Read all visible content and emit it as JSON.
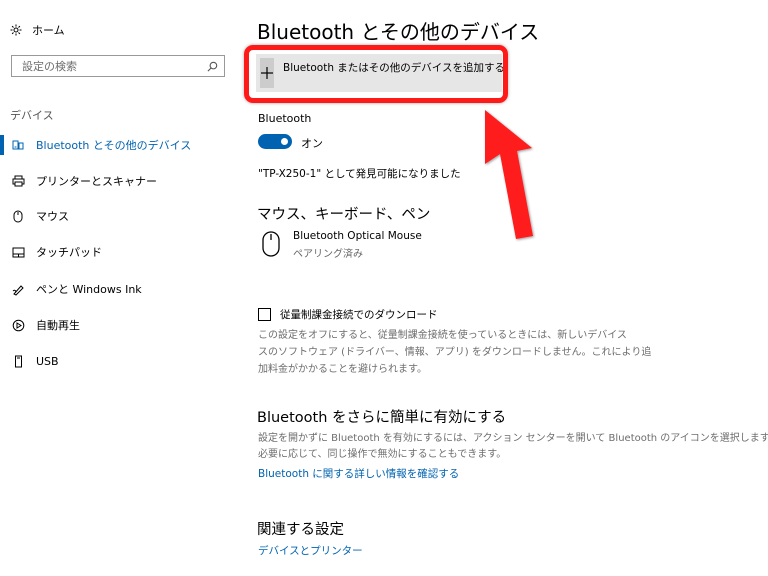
{
  "sidebar": {
    "home_label": "ホーム",
    "search_placeholder": "設定の検索",
    "section_label": "デバイス",
    "items": [
      {
        "label": "Bluetooth とその他のデバイス",
        "icon": "bluetooth-devices-icon",
        "active": true
      },
      {
        "label": "プリンターとスキャナー",
        "icon": "printer-icon",
        "active": false
      },
      {
        "label": "マウス",
        "icon": "mouse-icon",
        "active": false
      },
      {
        "label": "タッチパッド",
        "icon": "touchpad-icon",
        "active": false
      },
      {
        "label": "ペンと Windows Ink",
        "icon": "pen-icon",
        "active": false
      },
      {
        "label": "自動再生",
        "icon": "autoplay-icon",
        "active": false
      },
      {
        "label": "USB",
        "icon": "usb-icon",
        "active": false
      }
    ]
  },
  "main": {
    "title": "Bluetooth とその他のデバイス",
    "add_device_label": "Bluetooth またはその他のデバイスを追加する",
    "bluetooth_label": "Bluetooth",
    "toggle_state": "オン",
    "discoverable_text": "\"TP-X250-1\" として発見可能になりました",
    "mouse_section_title": "マウス、キーボード、ペン",
    "device": {
      "name": "Bluetooth Optical Mouse",
      "status": "ペアリング済み"
    },
    "metered_label": "従量制課金接続でのダウンロード",
    "metered_desc": [
      "この設定をオフにすると、従量制課金接続を使っているときには、新しいデバイス",
      "スのソフトウェア (ドライバー、情報、アプリ) をダウンロードしません。これにより追",
      "加料金がかかることを避けられます。"
    ],
    "easy_title": "Bluetooth をさらに簡単に有効にする",
    "easy_desc": [
      "設定を開かずに Bluetooth を有効にするには、アクション センターを開いて Bluetooth のアイコンを選択します。",
      "必要に応じて、同じ操作で無効にすることもできます。"
    ],
    "learn_more_link": "Bluetooth に関する詳しい情報を確認する",
    "related_title": "関連する設定",
    "related_link": "デバイスとプリンター"
  },
  "colors": {
    "accent": "#0063b1",
    "highlight": "#ff1a1a"
  }
}
